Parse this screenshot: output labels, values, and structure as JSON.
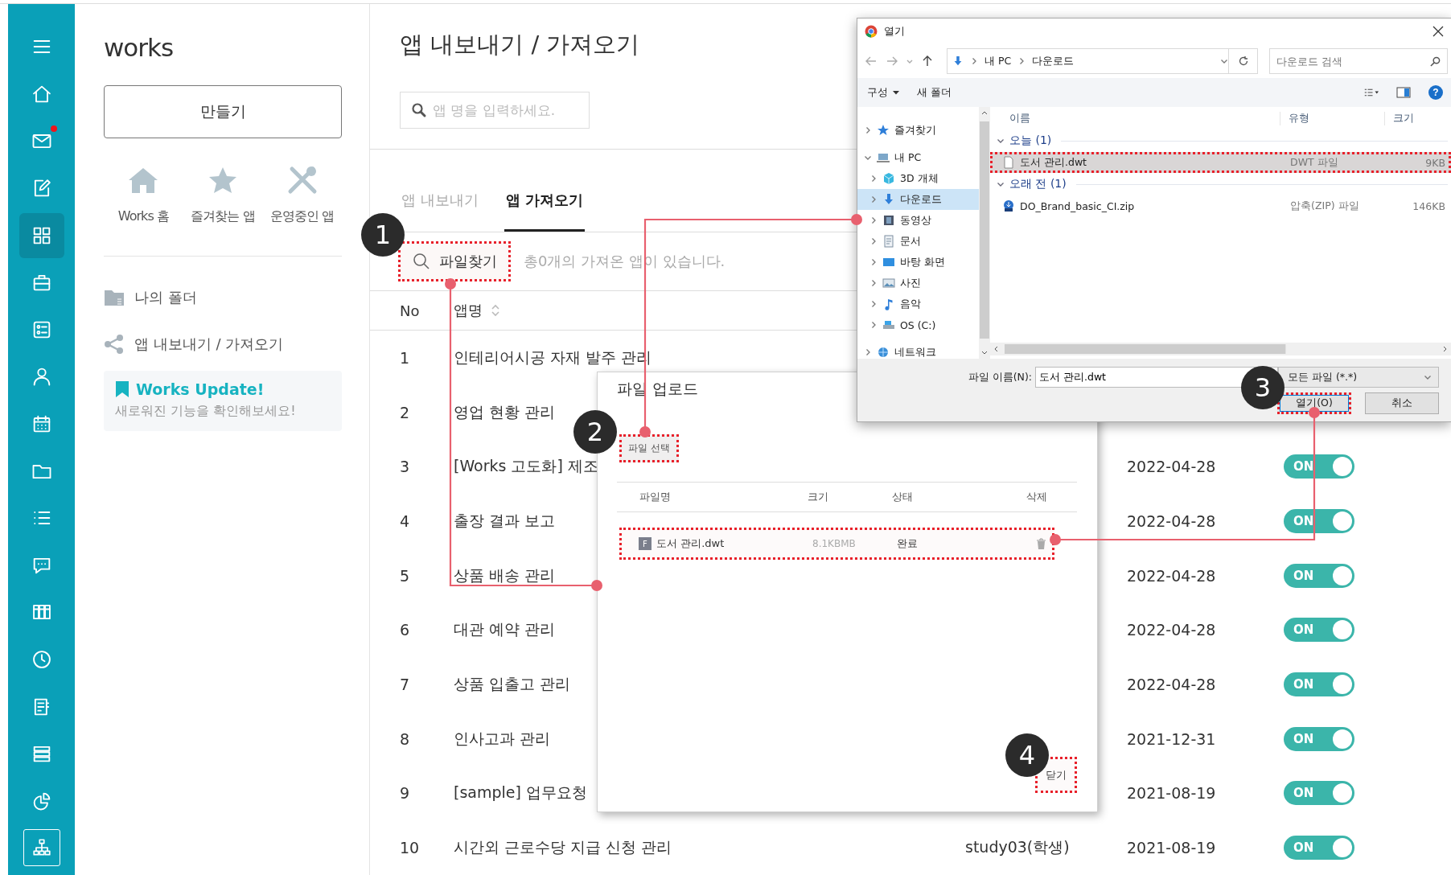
{
  "rail": [
    {
      "kind": "menu",
      "selected": false,
      "notification": false
    },
    {
      "kind": "home",
      "selected": false,
      "notification": false
    },
    {
      "kind": "mail",
      "selected": false,
      "notification": true
    },
    {
      "kind": "edit",
      "selected": false,
      "notification": false
    },
    {
      "kind": "apps",
      "selected": true,
      "notification": false
    },
    {
      "kind": "briefcase",
      "selected": false,
      "notification": false
    },
    {
      "kind": "form",
      "selected": false,
      "notification": false
    },
    {
      "kind": "person",
      "selected": false,
      "notification": false
    },
    {
      "kind": "calendar",
      "selected": false,
      "notification": false
    },
    {
      "kind": "folder",
      "selected": false,
      "notification": false
    },
    {
      "kind": "list",
      "selected": false,
      "notification": false
    },
    {
      "kind": "chat",
      "selected": false,
      "notification": false
    },
    {
      "kind": "columns",
      "selected": false,
      "notification": false
    },
    {
      "kind": "clock",
      "selected": false,
      "notification": false
    },
    {
      "kind": "doc",
      "selected": false,
      "notification": false
    },
    {
      "kind": "stack",
      "selected": false,
      "notification": false
    },
    {
      "kind": "chart",
      "selected": false,
      "notification": false
    },
    {
      "kind": "org",
      "selected": false,
      "notification": false
    }
  ],
  "sidebar": {
    "title": "works",
    "create_button": "만들기",
    "shortcuts": [
      {
        "kind": "home",
        "label": "Works 홈"
      },
      {
        "kind": "star",
        "label": "즐겨찾는 앱"
      },
      {
        "kind": "tools",
        "label": "운영중인 앱"
      }
    ],
    "links": [
      {
        "kind": "folder",
        "label": "나의 폴더"
      },
      {
        "kind": "share",
        "label": "앱 내보내기 / 가져오기"
      }
    ],
    "update_card": {
      "title": "Works Update!",
      "text": "새로워진 기능을 확인해보세요!"
    }
  },
  "main": {
    "title": "앱 내보내기 / 가져오기",
    "search": {
      "placeholder": "앱 명을 입력하세요."
    },
    "tabs": [
      {
        "label": "앱 내보내기",
        "selected": false
      },
      {
        "label": "앱 가져오기",
        "selected": true
      }
    ],
    "toolbar": {
      "find_button": {
        "label": "파일찾기",
        "highlighted": true
      },
      "summary": "총0개의 가져온 앱이 있습니다."
    },
    "table": {
      "columns": [
        {
          "label": "No",
          "sortable": false
        },
        {
          "label": "앱명",
          "sortable": true
        }
      ],
      "rows": [
        {
          "no": "1",
          "name": "인테리어시공 자재 발주 관리"
        },
        {
          "no": "2",
          "name": "영업 현황 관리"
        },
        {
          "no": "3",
          "name": "[Works 고도화] 제조",
          "date": "2022-04-28",
          "toggle": {
            "on": true,
            "label": "ON"
          }
        },
        {
          "no": "4",
          "name": "출장 결과 보고",
          "date": "2022-04-28",
          "toggle": {
            "on": true,
            "label": "ON"
          }
        },
        {
          "no": "5",
          "name": "상품 배송 관리",
          "date": "2022-04-28",
          "toggle": {
            "on": true,
            "label": "ON"
          }
        },
        {
          "no": "6",
          "name": "대관 예약 관리",
          "date": "2022-04-28",
          "toggle": {
            "on": true,
            "label": "ON"
          }
        },
        {
          "no": "7",
          "name": "상품 입출고 관리",
          "date": "2022-04-28",
          "toggle": {
            "on": true,
            "label": "ON"
          }
        },
        {
          "no": "8",
          "name": "인사고과 관리",
          "date": "2021-12-31",
          "toggle": {
            "on": true,
            "label": "ON"
          }
        },
        {
          "no": "9",
          "name": "[sample] 업무요청",
          "date": "2021-08-19",
          "toggle": {
            "on": true,
            "label": "ON"
          }
        },
        {
          "no": "10",
          "name": "시간외 근로수당 지급 신청 관리",
          "creator": "study03(학생)",
          "date": "2021-08-19",
          "toggle": {
            "on": true,
            "label": "ON"
          }
        }
      ]
    }
  },
  "upload_dialog": {
    "title": "파일 업로드",
    "select_button": {
      "label": "파일 선택",
      "highlighted": true
    },
    "columns": [
      "파일명",
      "크기",
      "상태",
      "삭제"
    ],
    "files": [
      {
        "type_badge": "F",
        "name": "도서 관리.dwt",
        "size": "8.1KBMB",
        "status": "완료",
        "highlighted": true
      }
    ],
    "close_button": {
      "label": "닫기",
      "highlighted": true
    }
  },
  "file_dialog": {
    "title": "열기",
    "path": [
      "내 PC",
      "다운로드"
    ],
    "search": {
      "placeholder": "다운로드 검색"
    },
    "toolbar": [
      "구성",
      "새 폴더"
    ],
    "help": "?",
    "nav": [
      {
        "kind": "favorites",
        "label": "즐겨찾기",
        "expanded": false,
        "selected": false
      },
      {
        "kind": "pc",
        "label": "내 PC",
        "expanded": true,
        "selected": false,
        "children": [
          {
            "kind": "objects",
            "label": "3D 개체",
            "expanded": false,
            "selected": false
          },
          {
            "kind": "downloads",
            "label": "다운로드",
            "expanded": false,
            "selected": true
          },
          {
            "kind": "videos",
            "label": "동영상",
            "expanded": false,
            "selected": false
          },
          {
            "kind": "documents",
            "label": "문서",
            "expanded": false,
            "selected": false
          },
          {
            "kind": "desktop",
            "label": "바탕 화면",
            "expanded": false,
            "selected": false
          },
          {
            "kind": "pictures",
            "label": "사진",
            "expanded": false,
            "selected": false
          },
          {
            "kind": "music",
            "label": "음악",
            "expanded": false,
            "selected": false
          },
          {
            "kind": "drive",
            "label": "OS (C:)",
            "expanded": false,
            "selected": false
          }
        ]
      },
      {
        "kind": "network",
        "label": "네트워크",
        "expanded": false,
        "selected": false
      }
    ],
    "columns": [
      "이름",
      "유형",
      "크기"
    ],
    "groups": [
      {
        "label": "오늘 (1)",
        "expanded": true,
        "files": [
          {
            "kind": "document",
            "name": "도서 관리.dwt",
            "type": "DWT 파일",
            "size": "9KB",
            "selected": true,
            "highlighted": true
          }
        ]
      },
      {
        "label": "오래 전 (1)",
        "expanded": true,
        "files": [
          {
            "kind": "zip",
            "name": "DO_Brand_basic_CI.zip",
            "type": "압축(ZIP) 파일",
            "size": "146KB",
            "selected": false,
            "highlighted": false
          }
        ]
      }
    ],
    "filename_label": "파일 이름(N):",
    "filename_value": "도서 관리.dwt",
    "filter": "모든 파일 (*.*)",
    "buttons": [
      {
        "label": "열기(O)",
        "kind": "primary",
        "highlighted": true
      },
      {
        "label": "취소",
        "kind": "secondary",
        "highlighted": false
      }
    ]
  },
  "annotations": [
    {
      "label": "1"
    },
    {
      "label": "2"
    },
    {
      "label": "3"
    },
    {
      "label": "4"
    }
  ]
}
